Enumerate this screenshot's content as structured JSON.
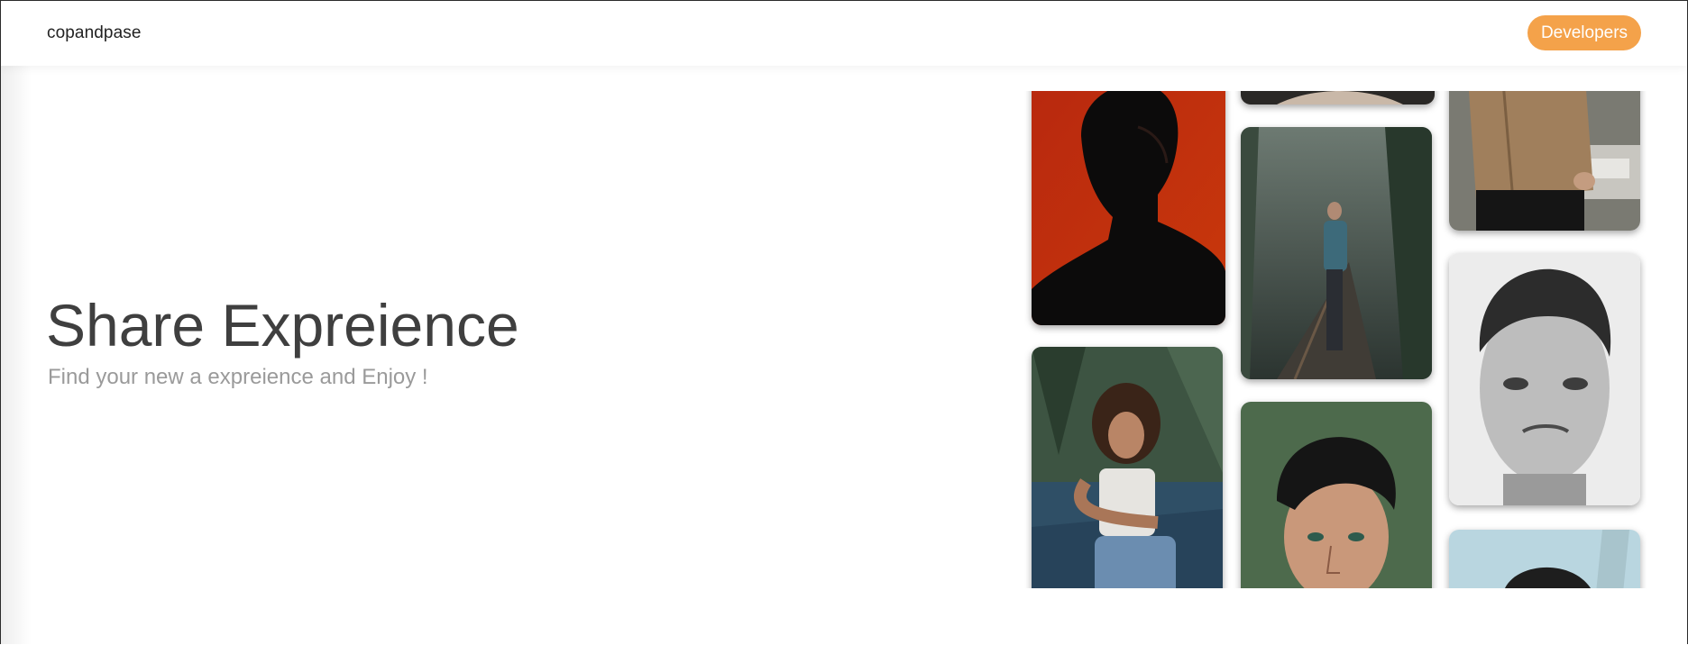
{
  "header": {
    "brand": "copandpase",
    "developers_label": "Developers"
  },
  "hero": {
    "title": "Share Expreience",
    "subtitle": "Find your new a expreience and Enjoy !"
  },
  "colors": {
    "accent": "#f4a24a",
    "title_text": "#3f3f3f",
    "subtitle_text": "#9a9a9a"
  },
  "gallery": {
    "photos": [
      "man-silhouette-red-background-photo",
      "woman-sitting-poolside-photo",
      "cropped-portrait-photo-top",
      "man-in-forest-with-phone-photo",
      "curly-haired-young-man-photo",
      "person-in-tan-jacket-photo",
      "black-white-man-portrait-photo",
      "man-portrait-partial-photo"
    ]
  }
}
